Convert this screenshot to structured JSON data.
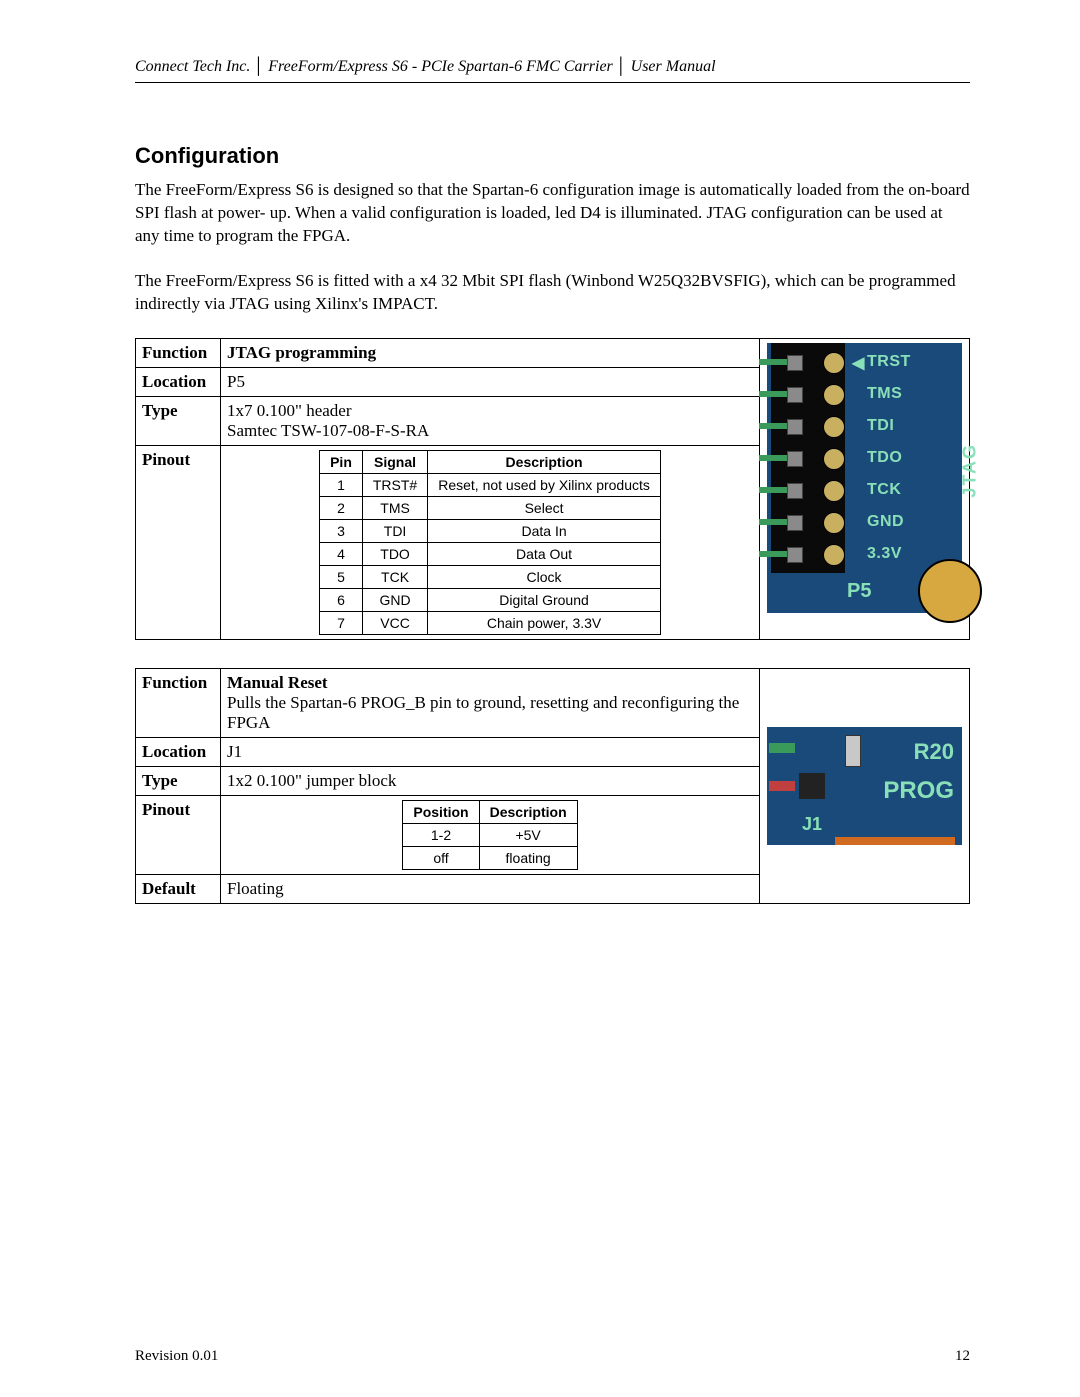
{
  "header": "Connect Tech Inc. │ FreeForm/Express S6 - PCIe Spartan-6 FMC Carrier │ User Manual",
  "section_title": "Configuration",
  "para1": "The FreeForm/Express S6 is designed so that the Spartan-6 configuration image is automatically loaded from the on-board SPI flash at power- up.  When a valid configuration is loaded, led D4 is illuminated.  JTAG configuration can be used at any time to program the FPGA.",
  "para2": "The FreeForm/Express S6 is fitted with a x4 32 Mbit SPI flash (Winbond W25Q32BVSFIG), which can be programmed indirectly via JTAG using Xilinx's IMPACT.",
  "labels": {
    "function": "Function",
    "location": "Location",
    "type": "Type",
    "pinout": "Pinout",
    "default": "Default"
  },
  "jtag": {
    "function": "JTAG programming",
    "location": "P5",
    "type_line1": "1x7 0.100\" header",
    "type_line2": "Samtec TSW-107-08-F-S-RA",
    "headers": {
      "pin": "Pin",
      "signal": "Signal",
      "desc": "Description"
    },
    "rows": [
      {
        "pin": "1",
        "signal": "TRST#",
        "desc": "Reset, not used by Xilinx products"
      },
      {
        "pin": "2",
        "signal": "TMS",
        "desc": "Select"
      },
      {
        "pin": "3",
        "signal": "TDI",
        "desc": "Data In"
      },
      {
        "pin": "4",
        "signal": "TDO",
        "desc": "Data Out"
      },
      {
        "pin": "5",
        "signal": "TCK",
        "desc": "Clock"
      },
      {
        "pin": "6",
        "signal": "GND",
        "desc": "Digital Ground"
      },
      {
        "pin": "7",
        "signal": "VCC",
        "desc": "Chain power, 3.3V"
      }
    ],
    "silk": {
      "pins": [
        "TRST",
        "TMS",
        "TDI",
        "TDO",
        "TCK",
        "GND",
        "3.3V"
      ],
      "side": "JTAG",
      "ref": "P5"
    }
  },
  "reset": {
    "function_title": "Manual Reset",
    "function_desc": "Pulls the Spartan-6 PROG_B pin to ground, resetting and reconfiguring the FPGA",
    "location": "J1",
    "type": "1x2 0.100\" jumper block",
    "headers": {
      "pos": "Position",
      "desc": "Description"
    },
    "rows": [
      {
        "pos": "1-2",
        "desc": "+5V"
      },
      {
        "pos": "off",
        "desc": "floating"
      }
    ],
    "default": "Floating",
    "silk": {
      "r20": "R20",
      "prog": "PROG",
      "j1": "J1"
    }
  },
  "footer": {
    "rev": "Revision 0.01",
    "page": "12"
  }
}
